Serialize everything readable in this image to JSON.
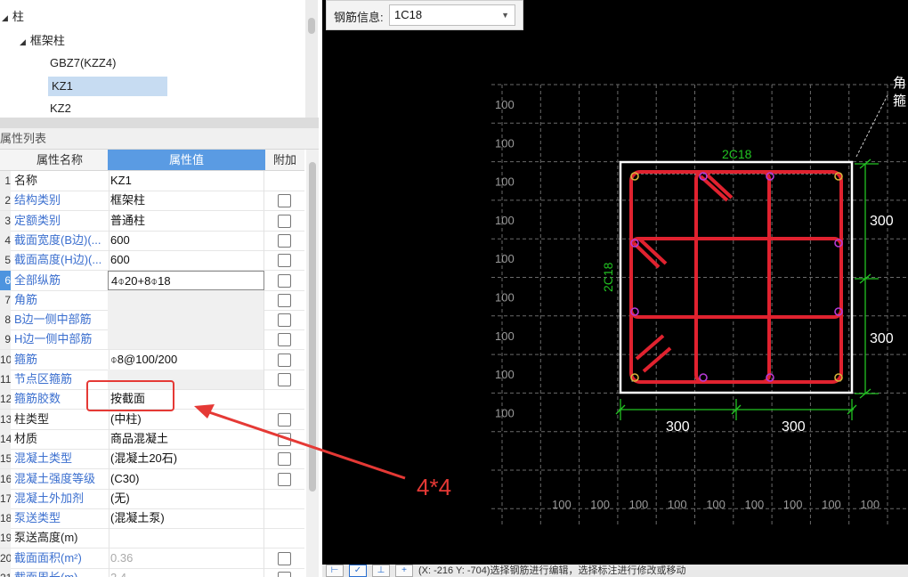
{
  "tree": {
    "items": [
      {
        "label": "柱",
        "expanded": true
      },
      {
        "label": "框架柱",
        "expanded": true
      },
      {
        "label": "GBZ7(KZZ4)"
      },
      {
        "label": "KZ1",
        "selected": true
      },
      {
        "label": "KZ2"
      }
    ]
  },
  "properties": {
    "title": "属性列表",
    "headers": {
      "name": "属性名称",
      "value": "属性值",
      "extra": "附加"
    },
    "rows": [
      {
        "num": "1",
        "name": "名称",
        "value": "KZ1",
        "checkbox": false
      },
      {
        "num": "2",
        "name": "结构类别",
        "value": "框架柱",
        "checkbox": true
      },
      {
        "num": "3",
        "name": "定额类别",
        "value": "普通柱",
        "checkbox": true
      },
      {
        "num": "4",
        "name": "截面宽度(B边)(...",
        "value": "600",
        "checkbox": true
      },
      {
        "num": "5",
        "name": "截面高度(H边)(...",
        "value": "600",
        "checkbox": true
      },
      {
        "num": "6",
        "name": "全部纵筋",
        "value": "4⌽20+8⌽18",
        "checkbox": true,
        "active": true
      },
      {
        "num": "7",
        "name": "角筋",
        "value": "",
        "checkbox": true
      },
      {
        "num": "8",
        "name": "B边一侧中部筋",
        "value": "",
        "checkbox": true
      },
      {
        "num": "9",
        "name": "H边一侧中部筋",
        "value": "",
        "checkbox": true
      },
      {
        "num": "10",
        "name": "箍筋",
        "value": "⌽8@100/200",
        "checkbox": true
      },
      {
        "num": "11",
        "name": "节点区箍筋",
        "value": "",
        "checkbox": true
      },
      {
        "num": "12",
        "name": "箍筋胶数",
        "value": "按截面",
        "checkbox": false
      },
      {
        "num": "13",
        "name": "柱类型",
        "value": "(中柱)",
        "checkbox": true
      },
      {
        "num": "14",
        "name": "材质",
        "value": "商品混凝土",
        "checkbox": true
      },
      {
        "num": "15",
        "name": "混凝土类型",
        "value": "(混凝土20石)",
        "checkbox": true
      },
      {
        "num": "16",
        "name": "混凝土强度等级",
        "value": "(C30)",
        "checkbox": true
      },
      {
        "num": "17",
        "name": "混凝土外加剂",
        "value": "(无)",
        "checkbox": false
      },
      {
        "num": "18",
        "name": "泵送类型",
        "value": "(混凝土泵)",
        "checkbox": false
      },
      {
        "num": "19",
        "name": "泵送高度(m)",
        "value": "",
        "checkbox": false
      },
      {
        "num": "20",
        "name": "截面面积(m²)",
        "value": "0.36",
        "checkbox": true
      },
      {
        "num": "21",
        "name": "截面周长(m)",
        "value": "2.4",
        "checkbox": true
      }
    ]
  },
  "toolbar": {
    "label": "钢筋信息:",
    "value": "1C18"
  },
  "drawing": {
    "grid_label": "100",
    "top_rebar_label": "2C18",
    "left_rebar_label": "2C18",
    "dim_right_top": "300",
    "dim_right_bottom": "300",
    "dim_bottom_left": "300",
    "dim_bottom_right": "300",
    "callout_line1": "角",
    "callout_line2": "箍",
    "colors": {
      "rebar": "#e0222f",
      "dimension": "#22c322",
      "grid": "#6a6a6a",
      "border": "#ffffff"
    }
  },
  "annotation": {
    "text": "4*4",
    "color": "#e53935"
  },
  "status": {
    "text": "(X: -216 Y: -704)选择钢筋进行编辑，选择标注进行修改或移动"
  }
}
